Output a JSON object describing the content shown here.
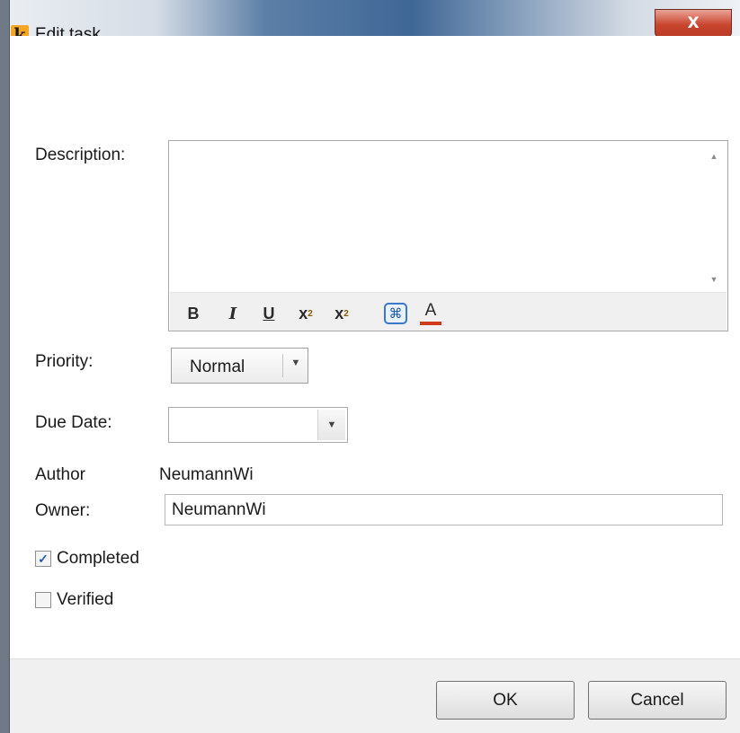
{
  "window": {
    "title": "Edit task",
    "icon_letter": "k",
    "close_glyph": "X",
    "accent_color": "#f5a623"
  },
  "labels": {
    "description": "Description:",
    "priority": "Priority:",
    "due_date": "Due Date:",
    "author": "Author",
    "owner": "Owner:"
  },
  "description": {
    "value": "",
    "toolbar": {
      "bold": "B",
      "italic": "I",
      "underline": "U",
      "superscript": "x",
      "superscript_mark": "2",
      "subscript": "x",
      "subscript_mark": "2",
      "special_char": "⌘",
      "font_color": "A"
    }
  },
  "priority": {
    "selected": "Normal"
  },
  "due_date": {
    "value": ""
  },
  "author": {
    "value": "NeumannWi"
  },
  "owner": {
    "value": "NeumannWi"
  },
  "checkboxes": {
    "completed": {
      "label": "Completed",
      "checked": true,
      "mark": "✓"
    },
    "verified": {
      "label": "Verified",
      "checked": false,
      "mark": ""
    }
  },
  "buttons": {
    "ok": "OK",
    "cancel": "Cancel"
  }
}
